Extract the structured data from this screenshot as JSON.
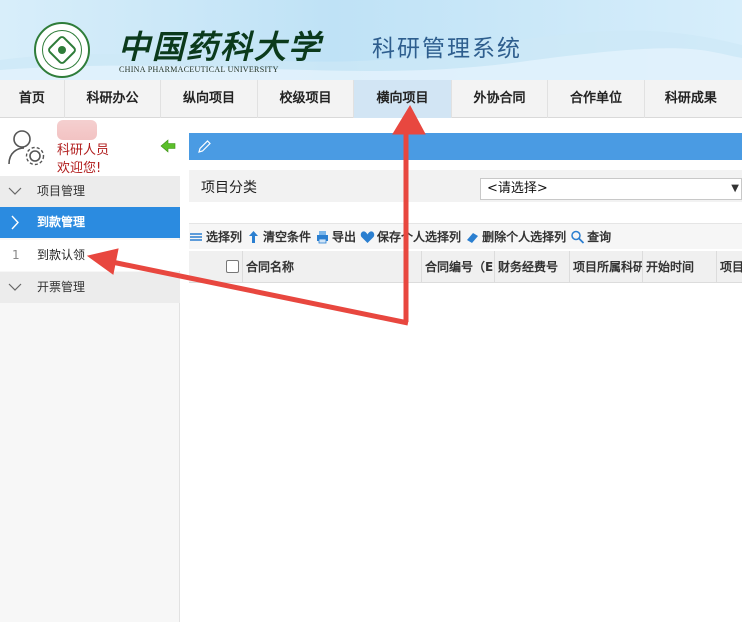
{
  "header": {
    "university_cn": "中国药科大学",
    "university_en": "CHINA PHARMACEUTICAL UNIVERSITY",
    "system_title": "科研管理系统"
  },
  "nav": {
    "items": [
      {
        "label": "首页"
      },
      {
        "label": "科研办公"
      },
      {
        "label": "纵向项目"
      },
      {
        "label": "校级项目"
      },
      {
        "label": "横向项目",
        "active": true
      },
      {
        "label": "外协合同"
      },
      {
        "label": "合作单位"
      },
      {
        "label": "科研成果"
      }
    ]
  },
  "user": {
    "role": "科研人员",
    "welcome": "欢迎您!"
  },
  "sidebar": {
    "project_mgmt": "项目管理",
    "payment_mgmt": "到款管理",
    "payment_claim_num": "1",
    "payment_claim": "到款认领",
    "invoice_mgmt": "开票管理"
  },
  "filter": {
    "label": "项目分类",
    "select_value": "<请选择>"
  },
  "toolbar": {
    "select_columns": "选择列",
    "clear_conditions": "清空条件",
    "export": "导出",
    "save_personal_columns": "保存个人选择列",
    "delete_personal_columns": "删除个人选择列",
    "query": "查询"
  },
  "grid": {
    "columns": [
      "合同名称",
      "合同编号（E",
      "财务经费号",
      "项目所属科研",
      "开始时间",
      "项目"
    ]
  },
  "colors": {
    "accent_blue": "#2b8be0",
    "bar_blue": "#4a9be3",
    "annotation_red": "#e8473f",
    "welcome_red": "#b11d1d"
  }
}
